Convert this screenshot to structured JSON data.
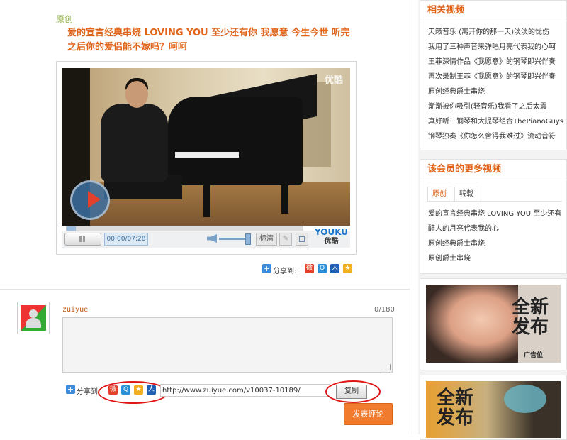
{
  "post": {
    "tag": "原创",
    "title": "爱的宣言经典串烧 LOVING YOU 至少还有你 我愿意 今生今世 听完之后你的爱侣能不嫁吗？呵呵"
  },
  "player": {
    "watermark": "优酷",
    "time": "00:00/07:28",
    "quality_label": "标清",
    "brand": "YOUKU",
    "brand_cn": "优酷",
    "progress": 0.04,
    "volume": 0.9
  },
  "share": {
    "label": "分享到:",
    "icons": [
      "sina-weibo-icon",
      "qq-weibo-icon",
      "renren-icon",
      "qzone-icon"
    ]
  },
  "comment": {
    "username": "zuiyue",
    "counter": "0/180",
    "share_label": "分享到:",
    "url": "http://www.zuiyue.com/v10037-10189/",
    "copy_label": "复制",
    "submit_label": "发表评论"
  },
  "related": {
    "title": "相关视频",
    "items": [
      "天籁音乐 (离开你的那一天)淡淡的忧伤",
      "我用了三种声音来弹唱月亮代表我的心呵",
      "王菲深情作品《我愿意》的钢琴即兴伴奏",
      "再次录制王菲《我愿意》的钢琴即兴伴奏",
      "原创经典爵士串烧",
      "渐渐被你吸引(轻音乐)我看了之后太震",
      "真好听！钢琴和大提琴组合ThePianoGuys",
      "钢琴独奏《你怎么舍得我难过》流动音符"
    ]
  },
  "member": {
    "title": "该会员的更多视频",
    "tabs": [
      "原创",
      "转载"
    ],
    "items": [
      "爱的宣言经典串烧 LOVING YOU 至少还有",
      "醉人的月亮代表我的心",
      "原创经典爵士串烧",
      "原创爵士串烧"
    ]
  },
  "ads": [
    {
      "line1": "全新",
      "line2": "发布",
      "sub": "广告位"
    },
    {
      "line1": "全新",
      "line2": "发布"
    }
  ]
}
